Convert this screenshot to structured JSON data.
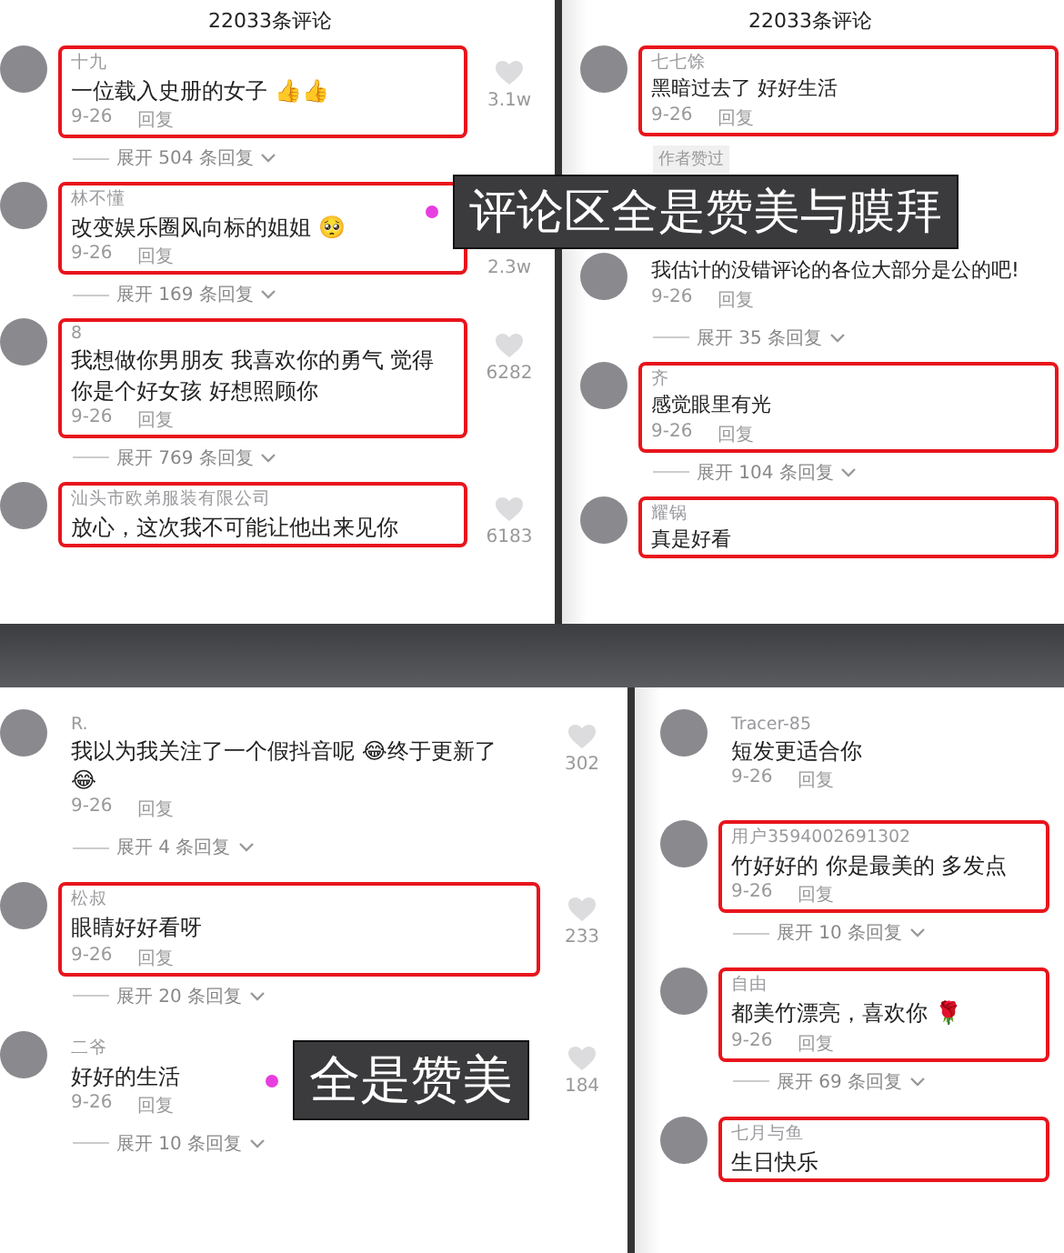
{
  "panels": [
    {
      "header": "22033条评论",
      "comments": [
        {
          "name": "十九",
          "text": "一位载入史册的女子 👍👍",
          "date": "9-26",
          "reply": "回复",
          "likes": "3.1w",
          "expand": "展开 504 条回复",
          "highlighted": true
        },
        {
          "name": "林不懂",
          "text": "改变娱乐圈风向标的姐姐 🥺",
          "date": "9-26",
          "reply": "回复",
          "likes": "2.3w",
          "like_icon": false,
          "expand": "展开 169 条回复",
          "highlighted": true
        },
        {
          "name": "8",
          "text": "我想做你男朋友 我喜欢你的勇气 觉得你是个好女孩 好想照顾你",
          "date": "9-26",
          "reply": "回复",
          "likes": "6282",
          "expand": "展开 769 条回复",
          "highlighted": true
        },
        {
          "name": "汕头市欧弟服装有限公司",
          "text": "放心，这次我不可能让他出来见你",
          "likes": "6183",
          "highlighted": true
        }
      ]
    },
    {
      "header": "22033条评论",
      "comments": [
        {
          "name": "七七馀",
          "text": "黑暗过去了 好好生活",
          "date": "9-26",
          "reply": "回复",
          "tag": "作者赞过",
          "highlighted": true
        },
        {
          "text": "我估计的没错评论的各位大部分是公的吧!",
          "date": "9-26",
          "reply": "回复",
          "expand": "展开 35 条回复",
          "highlighted": false
        },
        {
          "name": "齐",
          "text": "感觉眼里有光",
          "date": "9-26",
          "reply": "回复",
          "expand": "展开 104 条回复",
          "highlighted": true
        },
        {
          "name": "耀锅",
          "text": "真是好看",
          "highlighted": true
        }
      ]
    },
    {
      "comments": [
        {
          "name": "R.",
          "text": "我以为我关注了一个假抖音呢 😂终于更新了 😂",
          "date": "9-26",
          "reply": "回复",
          "likes": "302",
          "expand": "展开 4 条回复",
          "highlighted": false
        },
        {
          "name": "松叔",
          "text": "眼睛好好看呀",
          "date": "9-26",
          "reply": "回复",
          "likes": "233",
          "expand": "展开 20 条回复",
          "highlighted": true
        },
        {
          "name": "二爷",
          "text": "好好的生活",
          "date": "9-26",
          "reply": "回复",
          "likes": "184",
          "expand": "展开 10 条回复",
          "highlighted": false
        }
      ]
    },
    {
      "comments": [
        {
          "name": "Tracer-85",
          "text": "短发更适合你",
          "date": "9-26",
          "reply": "回复",
          "highlighted": false
        },
        {
          "name": "用户3594002691302",
          "text": "竹好好的 你是最美的 多发点",
          "date": "9-26",
          "reply": "回复",
          "expand": "展开 10 条回复",
          "highlighted": true
        },
        {
          "name": "自由",
          "text": "都美竹漂亮，喜欢你 🌹",
          "date": "9-26",
          "reply": "回复",
          "expand": "展开 69 条回复",
          "highlighted": true
        },
        {
          "name": "七月与鱼",
          "text": "生日快乐",
          "highlighted": true
        }
      ]
    }
  ],
  "captions": [
    "评论区全是赞美与膜拜",
    "全是赞美"
  ]
}
